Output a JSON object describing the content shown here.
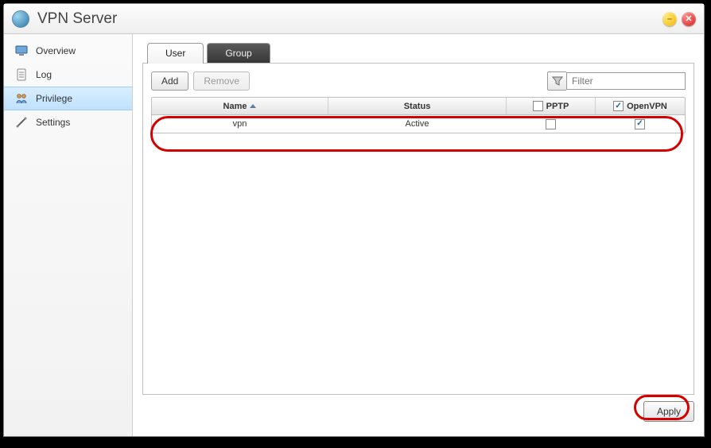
{
  "window": {
    "title": "VPN Server"
  },
  "sidebar": {
    "items": [
      {
        "label": "Overview",
        "selected": false
      },
      {
        "label": "Log",
        "selected": false
      },
      {
        "label": "Privilege",
        "selected": true
      },
      {
        "label": "Settings",
        "selected": false
      }
    ]
  },
  "tabs": {
    "user": "User",
    "group": "Group",
    "active": "user"
  },
  "toolbar": {
    "add_label": "Add",
    "remove_label": "Remove",
    "filter_placeholder": "Filter"
  },
  "table": {
    "headers": {
      "name": "Name",
      "status": "Status",
      "pptp": "PPTP",
      "openvpn": "OpenVPN"
    },
    "header_checks": {
      "pptp": false,
      "openvpn": true
    },
    "rows": [
      {
        "name": "vpn",
        "status": "Active",
        "pptp": false,
        "openvpn": true
      }
    ]
  },
  "footer": {
    "apply_label": "Apply"
  }
}
